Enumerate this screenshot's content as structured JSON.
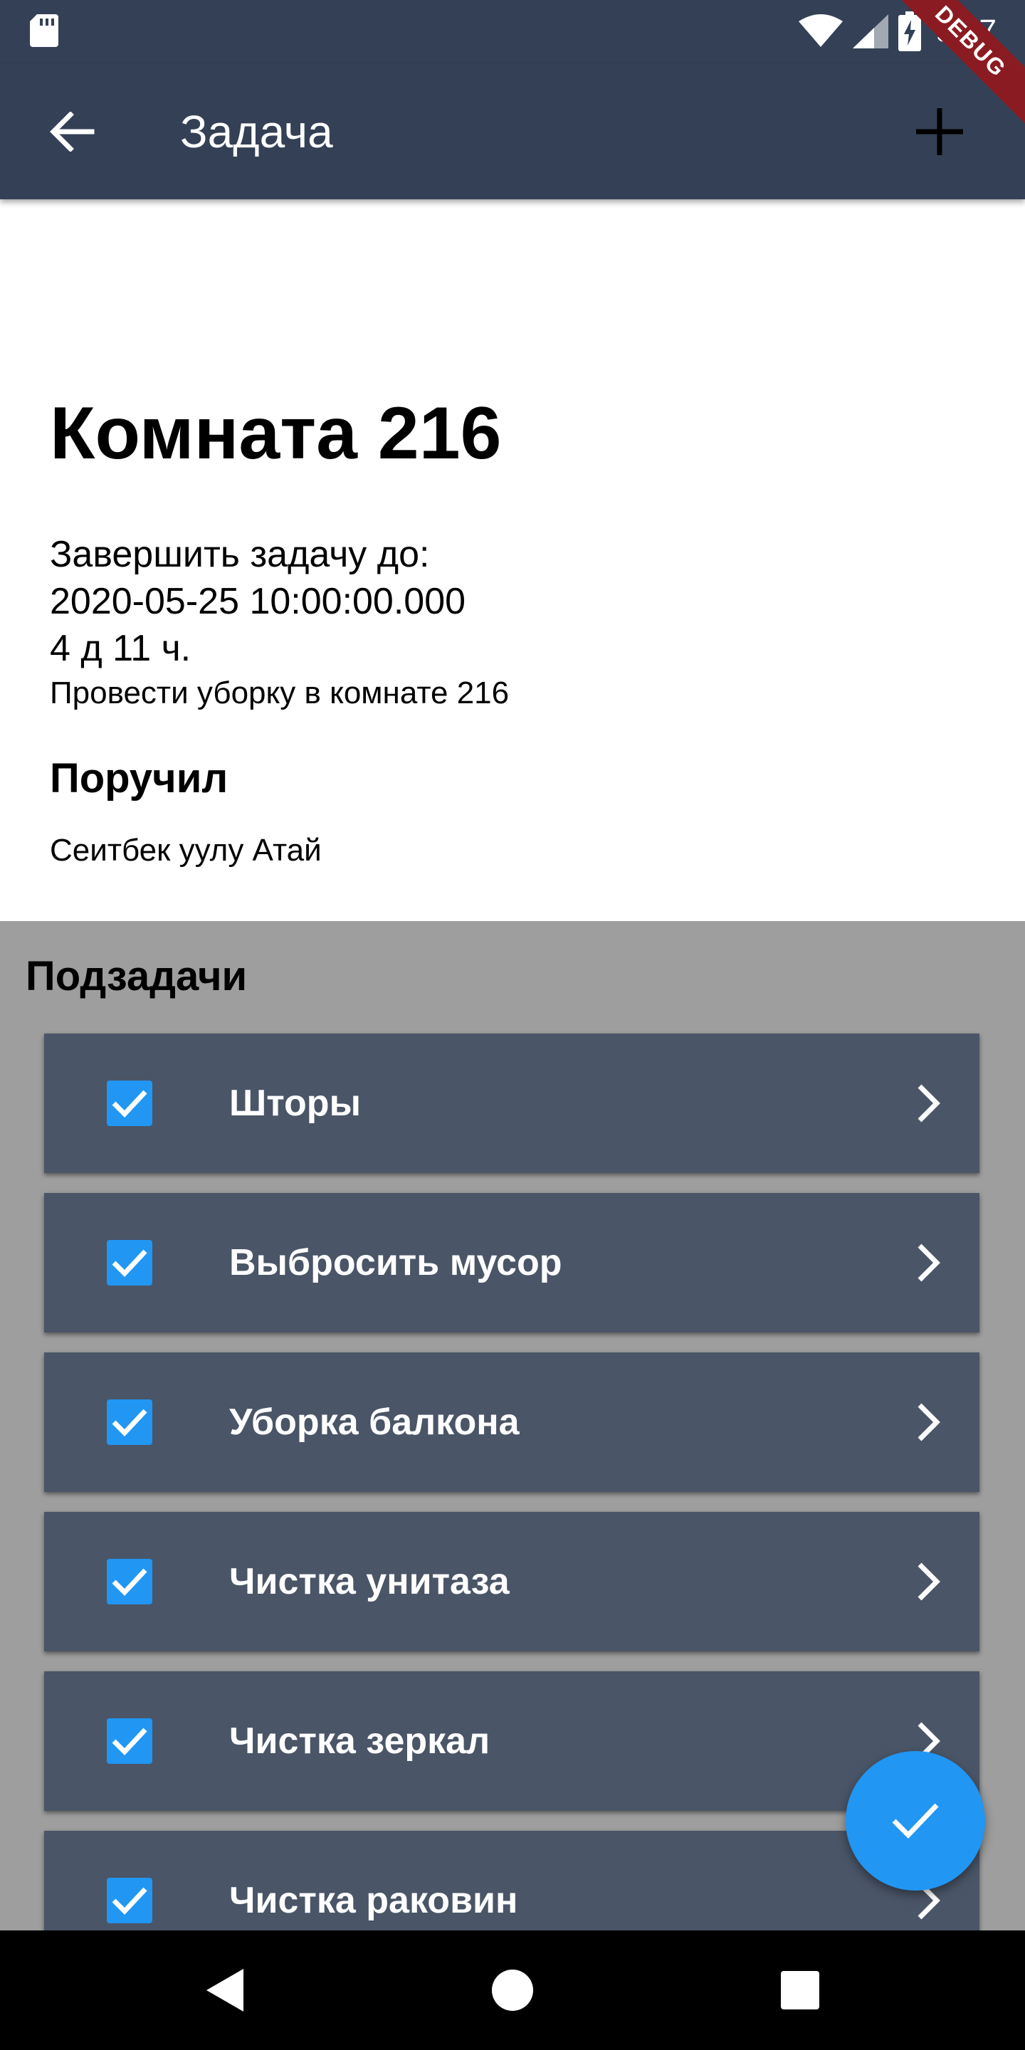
{
  "status_bar": {
    "time": "9:37",
    "icons": [
      "sd-card-icon",
      "wifi-icon",
      "signal-icon",
      "battery-charging-icon"
    ]
  },
  "debug_banner": "DEBUG",
  "app_bar": {
    "title": "Задача",
    "back_icon": "arrow-back-icon",
    "add_icon": "plus-icon"
  },
  "task": {
    "title": "Комната 216",
    "deadline_label": "Завершить задачу до:",
    "deadline_value": "2020-05-25 10:00:00.000",
    "time_left": "4 д 11 ч.",
    "description": "Провести уборку в комнате 216",
    "assigner_heading": "Поручил",
    "assigner_name": "Сеитбек уулу Атай"
  },
  "subtasks": {
    "heading": "Подзадачи",
    "items": [
      {
        "label": "Шторы",
        "checked": true
      },
      {
        "label": "Выбросить мусор",
        "checked": true
      },
      {
        "label": "Уборка балкона",
        "checked": true
      },
      {
        "label": "Чистка унитаза",
        "checked": true
      },
      {
        "label": "Чистка зеркал",
        "checked": true
      },
      {
        "label": "Чистка раковин",
        "checked": true
      }
    ]
  },
  "fab": {
    "icon": "check-icon"
  },
  "nav_bar": {
    "icons": [
      "back-triangle-icon",
      "home-circle-icon",
      "recents-square-icon"
    ]
  },
  "colors": {
    "app_bar": "#344055",
    "item_bg": "#4a5567",
    "section_bg": "#9e9e9e",
    "accent": "#2196f3",
    "debug": "#8b1b22"
  }
}
